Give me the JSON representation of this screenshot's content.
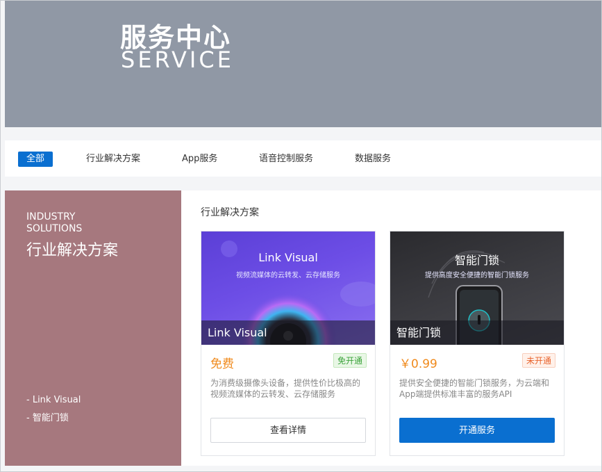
{
  "banner": {
    "title_zh": "服务中心",
    "title_en": "SERVICE"
  },
  "tabs": [
    {
      "label": "全部",
      "active": true
    },
    {
      "label": "行业解决方案"
    },
    {
      "label": "App服务"
    },
    {
      "label": "语音控制服务"
    },
    {
      "label": "数据服务"
    }
  ],
  "sidebar": {
    "title_en_line1": "INDUSTRY",
    "title_en_line2": "SOLUTIONS",
    "title_zh": "行业解决方案",
    "links": [
      "- Link Visual",
      "- 智能门锁"
    ]
  },
  "section": {
    "title": "行业解决方案"
  },
  "cards": [
    {
      "image_title": "Link Visual",
      "image_subtitle": "视频流媒体的云转发、云存储服务",
      "caption": "Link Visual",
      "price": "免费",
      "status": "免开通",
      "description": "为消费级摄像头设备，提供性价比极高的视频流媒体的云转发、云存储服务",
      "button": "查看详情"
    },
    {
      "image_title": "智能门锁",
      "image_subtitle": "提供高度安全便捷的智能门锁服务",
      "caption": "智能门锁",
      "price": "￥0.99",
      "status": "未开通",
      "description": "提供安全便捷的智能门锁服务，为云端和App端提供标准丰富的服务API",
      "button": "开通服务"
    }
  ],
  "colors": {
    "primary": "#0a6fd0",
    "banner": "#9098a5",
    "sidebar": "#a6787e",
    "price": "#f08a1c"
  }
}
